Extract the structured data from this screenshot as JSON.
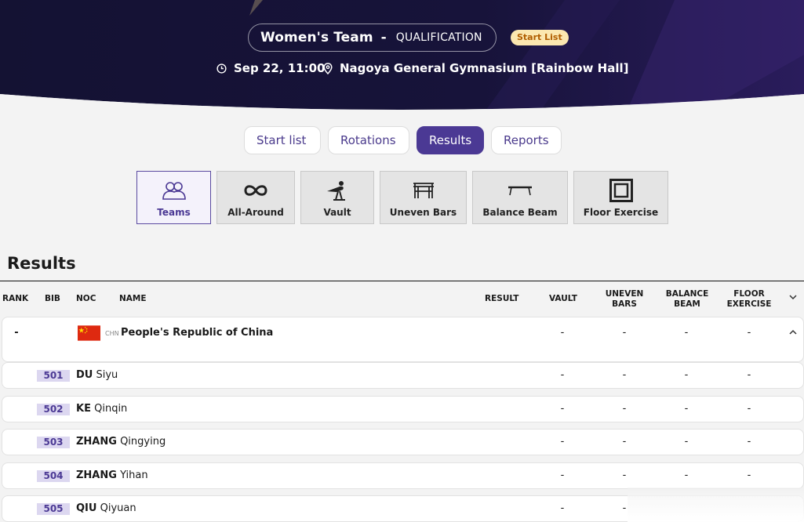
{
  "header": {
    "event_title": "Women's Team",
    "separator": "-",
    "phase": "QUALIFICATION",
    "status_badge": "Start List",
    "date_time": "Sep 22, 11:00",
    "venue": "Nagoya General Gymnasium [Rainbow Hall]"
  },
  "tabs": [
    {
      "label": "Start list",
      "active": false
    },
    {
      "label": "Rotations",
      "active": false
    },
    {
      "label": "Results",
      "active": true
    },
    {
      "label": "Reports",
      "active": false
    }
  ],
  "apparatus": [
    {
      "label": "Teams",
      "icon": "teams-icon",
      "active": true
    },
    {
      "label": "All-Around",
      "icon": "infinity-icon",
      "active": false
    },
    {
      "label": "Vault",
      "icon": "vault-icon",
      "active": false
    },
    {
      "label": "Uneven Bars",
      "icon": "uneven-bars-icon",
      "active": false
    },
    {
      "label": "Balance Beam",
      "icon": "balance-beam-icon",
      "active": false
    },
    {
      "label": "Floor Exercise",
      "icon": "floor-exercise-icon",
      "active": false
    }
  ],
  "results_heading": "Results",
  "table": {
    "headers": {
      "rank": "RANK",
      "bib": "BIB",
      "noc": "NOC",
      "name": "NAME",
      "result": "RESULT",
      "vault": "VAULT",
      "uneven_bars_1": "UNEVEN",
      "uneven_bars_2": "BARS",
      "balance_beam_1": "BALANCE",
      "balance_beam_2": "BEAM",
      "floor_exercise_1": "FLOOR",
      "floor_exercise_2": "EXERCISE"
    },
    "team": {
      "rank": "-",
      "noc_code": "CHN",
      "name": "People's Republic of China",
      "vault": "-",
      "uneven_bars": "-",
      "balance_beam": "-",
      "floor_exercise": "-"
    },
    "athletes": [
      {
        "bib": "501",
        "surname": "DU",
        "given": "Siyu",
        "vault": "-",
        "uneven_bars": "-",
        "balance_beam": "-",
        "floor_exercise": "-"
      },
      {
        "bib": "502",
        "surname": "KE",
        "given": "Qinqin",
        "vault": "-",
        "uneven_bars": "-",
        "balance_beam": "-",
        "floor_exercise": "-"
      },
      {
        "bib": "503",
        "surname": "ZHANG",
        "given": "Qingying",
        "vault": "-",
        "uneven_bars": "-",
        "balance_beam": "-",
        "floor_exercise": "-"
      },
      {
        "bib": "504",
        "surname": "ZHANG",
        "given": "Yihan",
        "vault": "-",
        "uneven_bars": "-",
        "balance_beam": "-",
        "floor_exercise": "-"
      },
      {
        "bib": "505",
        "surname": "QIU",
        "given": "Qiyuan",
        "vault": "-",
        "uneven_bars": "-",
        "balance_beam": "-",
        "floor_exercise": "-"
      }
    ]
  },
  "colors": {
    "header_bg": "#141233",
    "accent": "#4b3994",
    "badge_bg": "#fbe7b0",
    "badge_text": "#b05d00",
    "bib_bg": "#dcd7f0"
  }
}
